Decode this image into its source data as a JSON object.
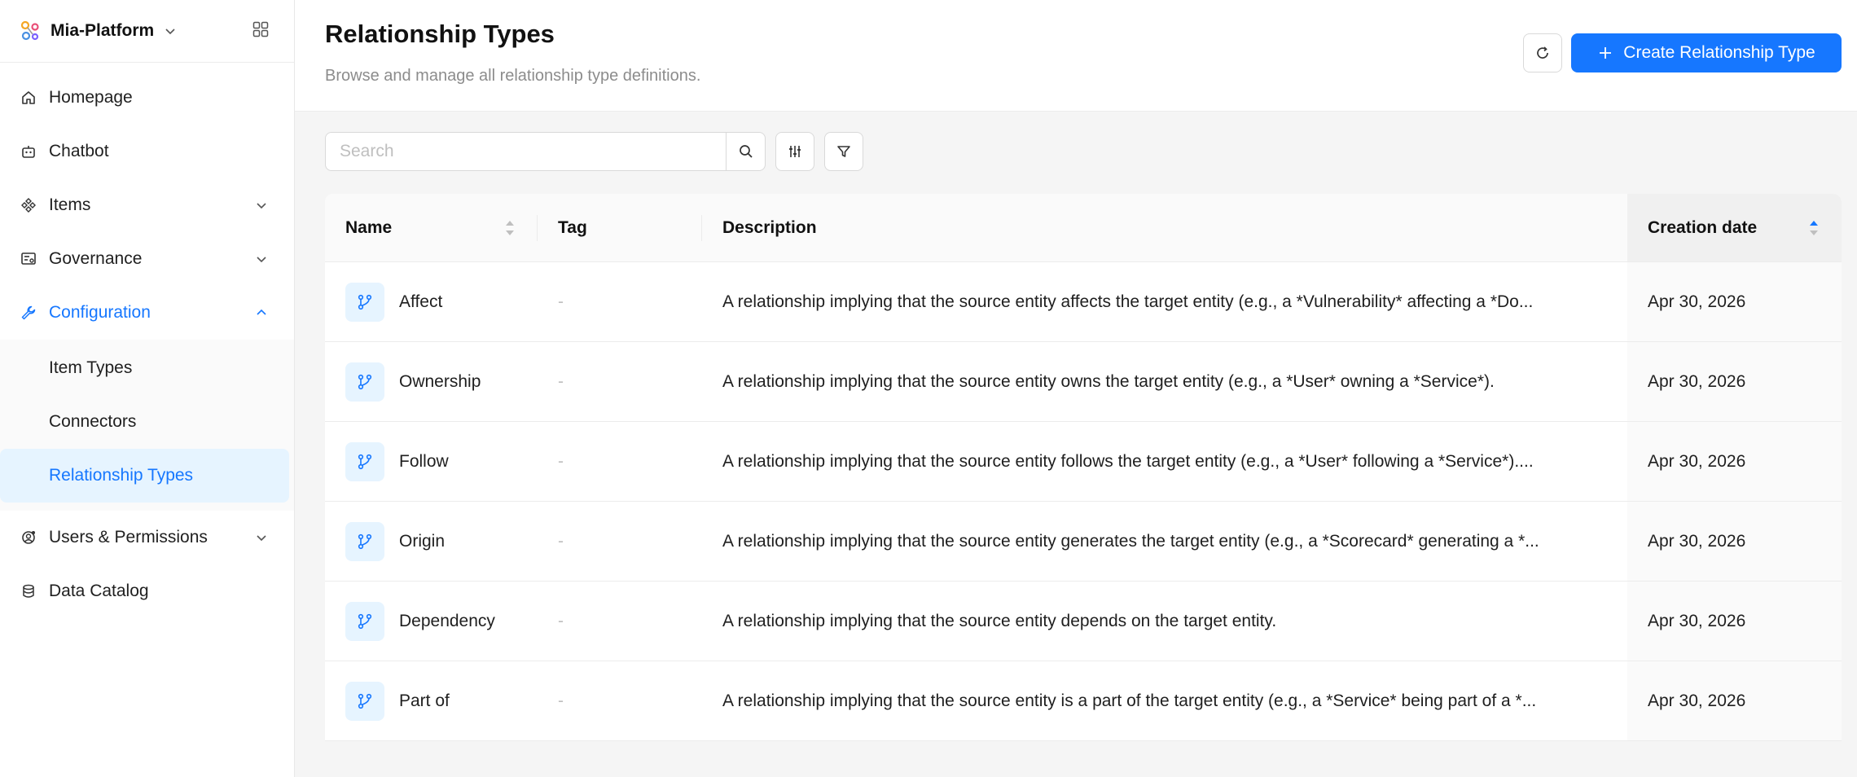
{
  "app": {
    "name": "Mia-Platform"
  },
  "sidebar": {
    "items": [
      {
        "label": "Homepage",
        "icon": "home-icon"
      },
      {
        "label": "Chatbot",
        "icon": "bot-icon"
      },
      {
        "label": "Items",
        "icon": "items-icon",
        "expandable": true
      },
      {
        "label": "Governance",
        "icon": "governance-icon",
        "expandable": true
      },
      {
        "label": "Configuration",
        "icon": "wrench-icon",
        "expanded": true,
        "active": true
      },
      {
        "label": "Users & Permissions",
        "icon": "users-icon",
        "expandable": true
      },
      {
        "label": "Data Catalog",
        "icon": "database-icon"
      }
    ],
    "config_subitems": [
      {
        "label": "Item Types"
      },
      {
        "label": "Connectors"
      },
      {
        "label": "Relationship Types",
        "selected": true
      }
    ]
  },
  "header": {
    "title": "Relationship Types",
    "subtitle": "Browse and manage all relationship type definitions.",
    "create_label": "Create Relationship Type"
  },
  "search": {
    "placeholder": "Search"
  },
  "table": {
    "columns": {
      "name": "Name",
      "tag": "Tag",
      "description": "Description",
      "date": "Creation date"
    },
    "rows": [
      {
        "name": "Affect",
        "tag": "-",
        "description": "A relationship implying that the source entity affects the target entity (e.g., a *Vulnerability* affecting a *Do...",
        "date": "Apr 30, 2026"
      },
      {
        "name": "Ownership",
        "tag": "-",
        "description": "A relationship implying that the source entity owns the target entity (e.g., a *User* owning a *Service*).",
        "date": "Apr 30, 2026"
      },
      {
        "name": "Follow",
        "tag": "-",
        "description": "A relationship implying that the source entity follows the target entity (e.g., a *User* following a *Service*)....",
        "date": "Apr 30, 2026"
      },
      {
        "name": "Origin",
        "tag": "-",
        "description": "A relationship implying that the source entity generates the target entity (e.g., a *Scorecard* generating a *...",
        "date": "Apr 30, 2026"
      },
      {
        "name": "Dependency",
        "tag": "-",
        "description": "A relationship implying that the source entity depends on the target entity.",
        "date": "Apr 30, 2026"
      },
      {
        "name": "Part of",
        "tag": "-",
        "description": "A relationship implying that the source entity is a part of the target entity (e.g., a *Service* being part of a *...",
        "date": "Apr 30, 2026"
      }
    ]
  },
  "colors": {
    "primary": "#1677ff",
    "selected_bg": "#e6f4ff",
    "muted": "#8c8c8c"
  }
}
